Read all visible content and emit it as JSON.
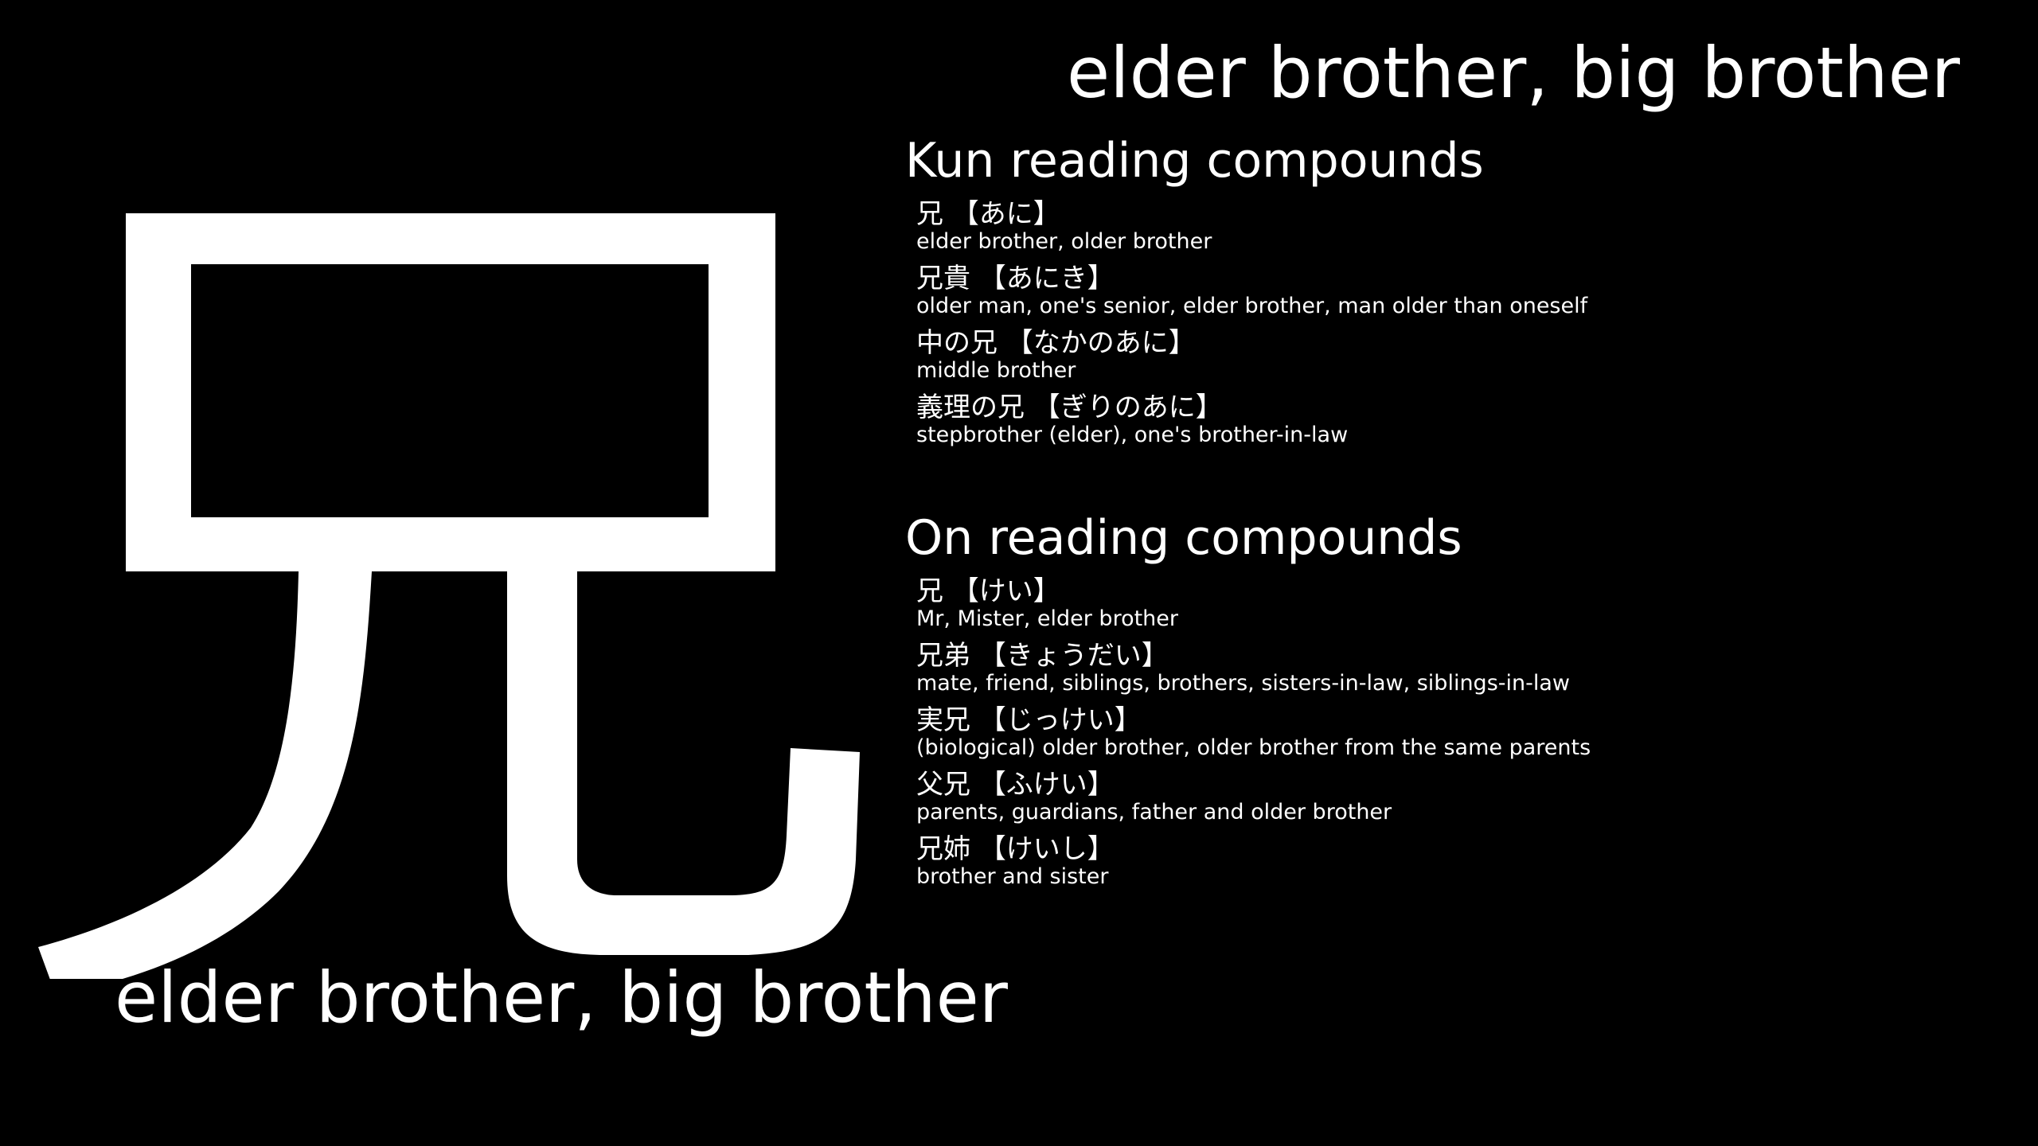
{
  "kanji": {
    "character": "兄",
    "meaning": "elder brother, big brother"
  },
  "header": {
    "meaning": "elder brother, big brother"
  },
  "kun": {
    "title": "Kun reading compounds",
    "items": [
      {
        "word": "兄 【あに】",
        "def": "elder brother, older brother"
      },
      {
        "word": "兄貴 【あにき】",
        "def": "older man, one's senior, elder brother, man older than oneself"
      },
      {
        "word": "中の兄 【なかのあに】",
        "def": "middle brother"
      },
      {
        "word": "義理の兄 【ぎりのあに】",
        "def": "stepbrother (elder), one's brother-in-law"
      }
    ]
  },
  "on": {
    "title": "On reading compounds",
    "items": [
      {
        "word": "兄 【けい】",
        "def": "Mr, Mister, elder brother"
      },
      {
        "word": "兄弟 【きょうだい】",
        "def": "mate, friend, siblings, brothers, sisters-in-law, siblings-in-law"
      },
      {
        "word": "実兄 【じっけい】",
        "def": "(biological) older brother, older brother from the same parents"
      },
      {
        "word": "父兄 【ふけい】",
        "def": "parents, guardians, father and older brother"
      },
      {
        "word": "兄姉 【けいし】",
        "def": "brother and sister"
      }
    ]
  },
  "colors": {
    "background": "#000000",
    "text": "#ffffff"
  }
}
